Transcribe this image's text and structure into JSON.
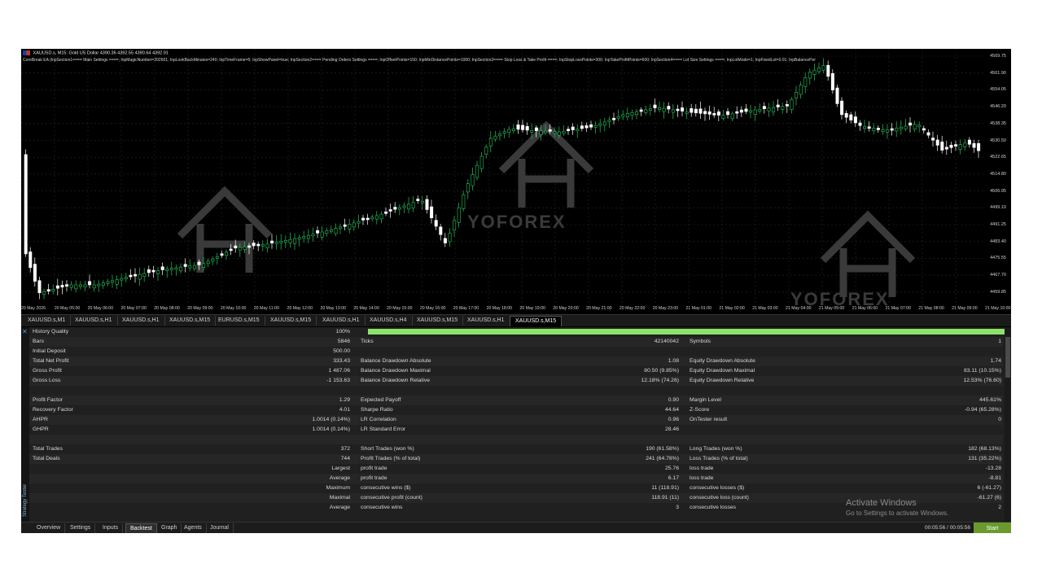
{
  "chart": {
    "symbol_header": "XAUUSD.s, M15:  Gold US Dollar  4390.36  4392.55  4390.64  4392.91",
    "info_line": "CoreBreak EA (InpSection1==== Main Settings ====; InpMagicNumber=202601; InpLookBackMinutes=240; InpTimeFrame=5; InpShowPanel=true; InpSection2==== Pending Orders Settings ====; InpOffsetPoints=150; InpMinDistancePoints=1000; InpSection3==== Stop Loss & Take Profit ====; InpStopLossPoints=300; InpTakeProfitPoints=600; InpSection4==== Lot Size Settings ====; InpLotMode=1; InpFixedLot=0.01; InpBalancePer",
    "watermark": "YOFOREX",
    "price_labels": [
      "4569.75",
      "4561.90",
      "4554.05",
      "4546.20",
      "4538.35",
      "4530.50",
      "4522.65",
      "4514.80",
      "4506.95",
      "4499.10",
      "4491.25",
      "4483.40",
      "4475.55",
      "4467.70",
      "4459.85"
    ],
    "time_labels": [
      "20 May 2026",
      "20 May 05:00",
      "20 May 06:00",
      "20 May 07:00",
      "20 May 08:00",
      "20 May 09:00",
      "20 May 10:00",
      "20 May 11:00",
      "20 May 12:00",
      "20 May 13:00",
      "20 May 14:00",
      "20 May 15:00",
      "20 May 16:00",
      "20 May 17:00",
      "20 May 18:00",
      "20 May 19:00",
      "20 May 20:00",
      "20 May 21:00",
      "20 May 22:00",
      "20 May 23:00",
      "21 May 01:00",
      "21 May 02:00",
      "21 May 03:00",
      "21 May 04:00",
      "21 May 05:00",
      "21 May 06:00",
      "21 May 07:00",
      "21 May 08:00",
      "21 May 09:00",
      "21 May 10:00"
    ],
    "colors": {
      "bull": "#22c55e",
      "bear": "#ffffff",
      "grid": "#2a2a2a"
    }
  },
  "symbol_tabs": [
    "XAUUSD.s,M1",
    "XAUUSD.s,H1",
    "XAUUSD.s,H1",
    "XAUUSD.s,M15",
    "EURUSD.s,M15",
    "XAUUSD.s,M15",
    "XAUUSD.s,H1",
    "XAUUSD.s,H4",
    "XAUUSD.s,M15",
    "XAUUSD.s,H1",
    "XAUUSD.s,M15"
  ],
  "tester": {
    "close_icon": "✕",
    "side_title": "Strategy Tester",
    "history_quality": {
      "label": "History Quality",
      "value": "100%",
      "fraction": 1.0
    },
    "rows": [
      {
        "c1l": "Bars",
        "c1v": "5846",
        "c2l": "Ticks",
        "c2v": "42140042",
        "c3l": "Symbols",
        "c3v": "1"
      },
      {
        "c1l": "Initial Deposit",
        "c1v": "500.00",
        "c2l": "",
        "c2v": "",
        "c3l": "",
        "c3v": ""
      },
      {
        "c1l": "Total Net Profit",
        "c1v": "333.43",
        "c2l": "Balance Drawdown Absolute",
        "c2v": "1.08",
        "c3l": "Equity Drawdown Absolute",
        "c3v": "1.74"
      },
      {
        "c1l": "Gross Profit",
        "c1v": "1 487.06",
        "c2l": "Balance Drawdown Maximal",
        "c2v": "80.50 (9.85%)",
        "c3l": "Equity Drawdown Maximal",
        "c3v": "83.11 (10.15%)"
      },
      {
        "c1l": "Gross Loss",
        "c1v": "-1 153.63",
        "c2l": "Balance Drawdown Relative",
        "c2v": "12.18% (74.26)",
        "c3l": "Equity Drawdown Relative",
        "c3v": "12.53% (76.60)"
      },
      {
        "c1l": "",
        "c1v": "",
        "c2l": "",
        "c2v": "",
        "c3l": "",
        "c3v": ""
      },
      {
        "c1l": "Profit Factor",
        "c1v": "1.29",
        "c2l": "Expected Payoff",
        "c2v": "0.90",
        "c3l": "Margin Level",
        "c3v": "445.61%"
      },
      {
        "c1l": "Recovery Factor",
        "c1v": "4.01",
        "c2l": "Sharpe Ratio",
        "c2v": "44.64",
        "c3l": "Z-Score",
        "c3v": "-0.94 (65.28%)"
      },
      {
        "c1l": "AHPR",
        "c1v": "1.0014 (0.14%)",
        "c2l": "LR Correlation",
        "c2v": "0.96",
        "c3l": "OnTester result",
        "c3v": "0"
      },
      {
        "c1l": "GHPR",
        "c1v": "1.0014 (0.14%)",
        "c2l": "LR Standard Error",
        "c2v": "28.46",
        "c3l": "",
        "c3v": ""
      },
      {
        "c1l": "",
        "c1v": "",
        "c2l": "",
        "c2v": "",
        "c3l": "",
        "c3v": ""
      },
      {
        "c1l": "Total Trades",
        "c1v": "372",
        "c2l": "Short Trades (won %)",
        "c2v": "190 (61.58%)",
        "c3l": "Long Trades (won %)",
        "c3v": "182 (68.13%)"
      },
      {
        "c1l": "Total Deals",
        "c1v": "744",
        "c2l": "Profit Trades (% of total)",
        "c2v": "241 (64.78%)",
        "c3l": "Loss Trades (% of total)",
        "c3v": "131 (35.22%)"
      },
      {
        "c1l": "",
        "c1v": "Largest",
        "c2l": "profit trade",
        "c2v": "25.76",
        "c3l": "loss trade",
        "c3v": "-13.28"
      },
      {
        "c1l": "",
        "c1v": "Average",
        "c2l": "profit trade",
        "c2v": "6.17",
        "c3l": "loss trade",
        "c3v": "-8.81"
      },
      {
        "c1l": "",
        "c1v": "Maximum",
        "c2l": "consecutive wins ($)",
        "c2v": "11 (118.91)",
        "c3l": "consecutive losses ($)",
        "c3v": "6 (-61.27)"
      },
      {
        "c1l": "",
        "c1v": "Maximal",
        "c2l": "consecutive profit (count)",
        "c2v": "118.91 (11)",
        "c3l": "consecutive loss (count)",
        "c3v": "-61.27 (6)"
      },
      {
        "c1l": "",
        "c1v": "Average",
        "c2l": "consecutive wins",
        "c2v": "3",
        "c3l": "consecutive losses",
        "c3v": "2"
      }
    ],
    "activate_title": "Activate Windows",
    "activate_sub": "Go to Settings to activate Windows."
  },
  "bottom_tabs": [
    "Overview",
    "Settings",
    "Inputs",
    "Backtest",
    "Graph",
    "Agents",
    "Journal"
  ],
  "active_bottom_tab": "Backtest",
  "timer": "00:05:56 / 00:05:56",
  "start_label": "Start"
}
